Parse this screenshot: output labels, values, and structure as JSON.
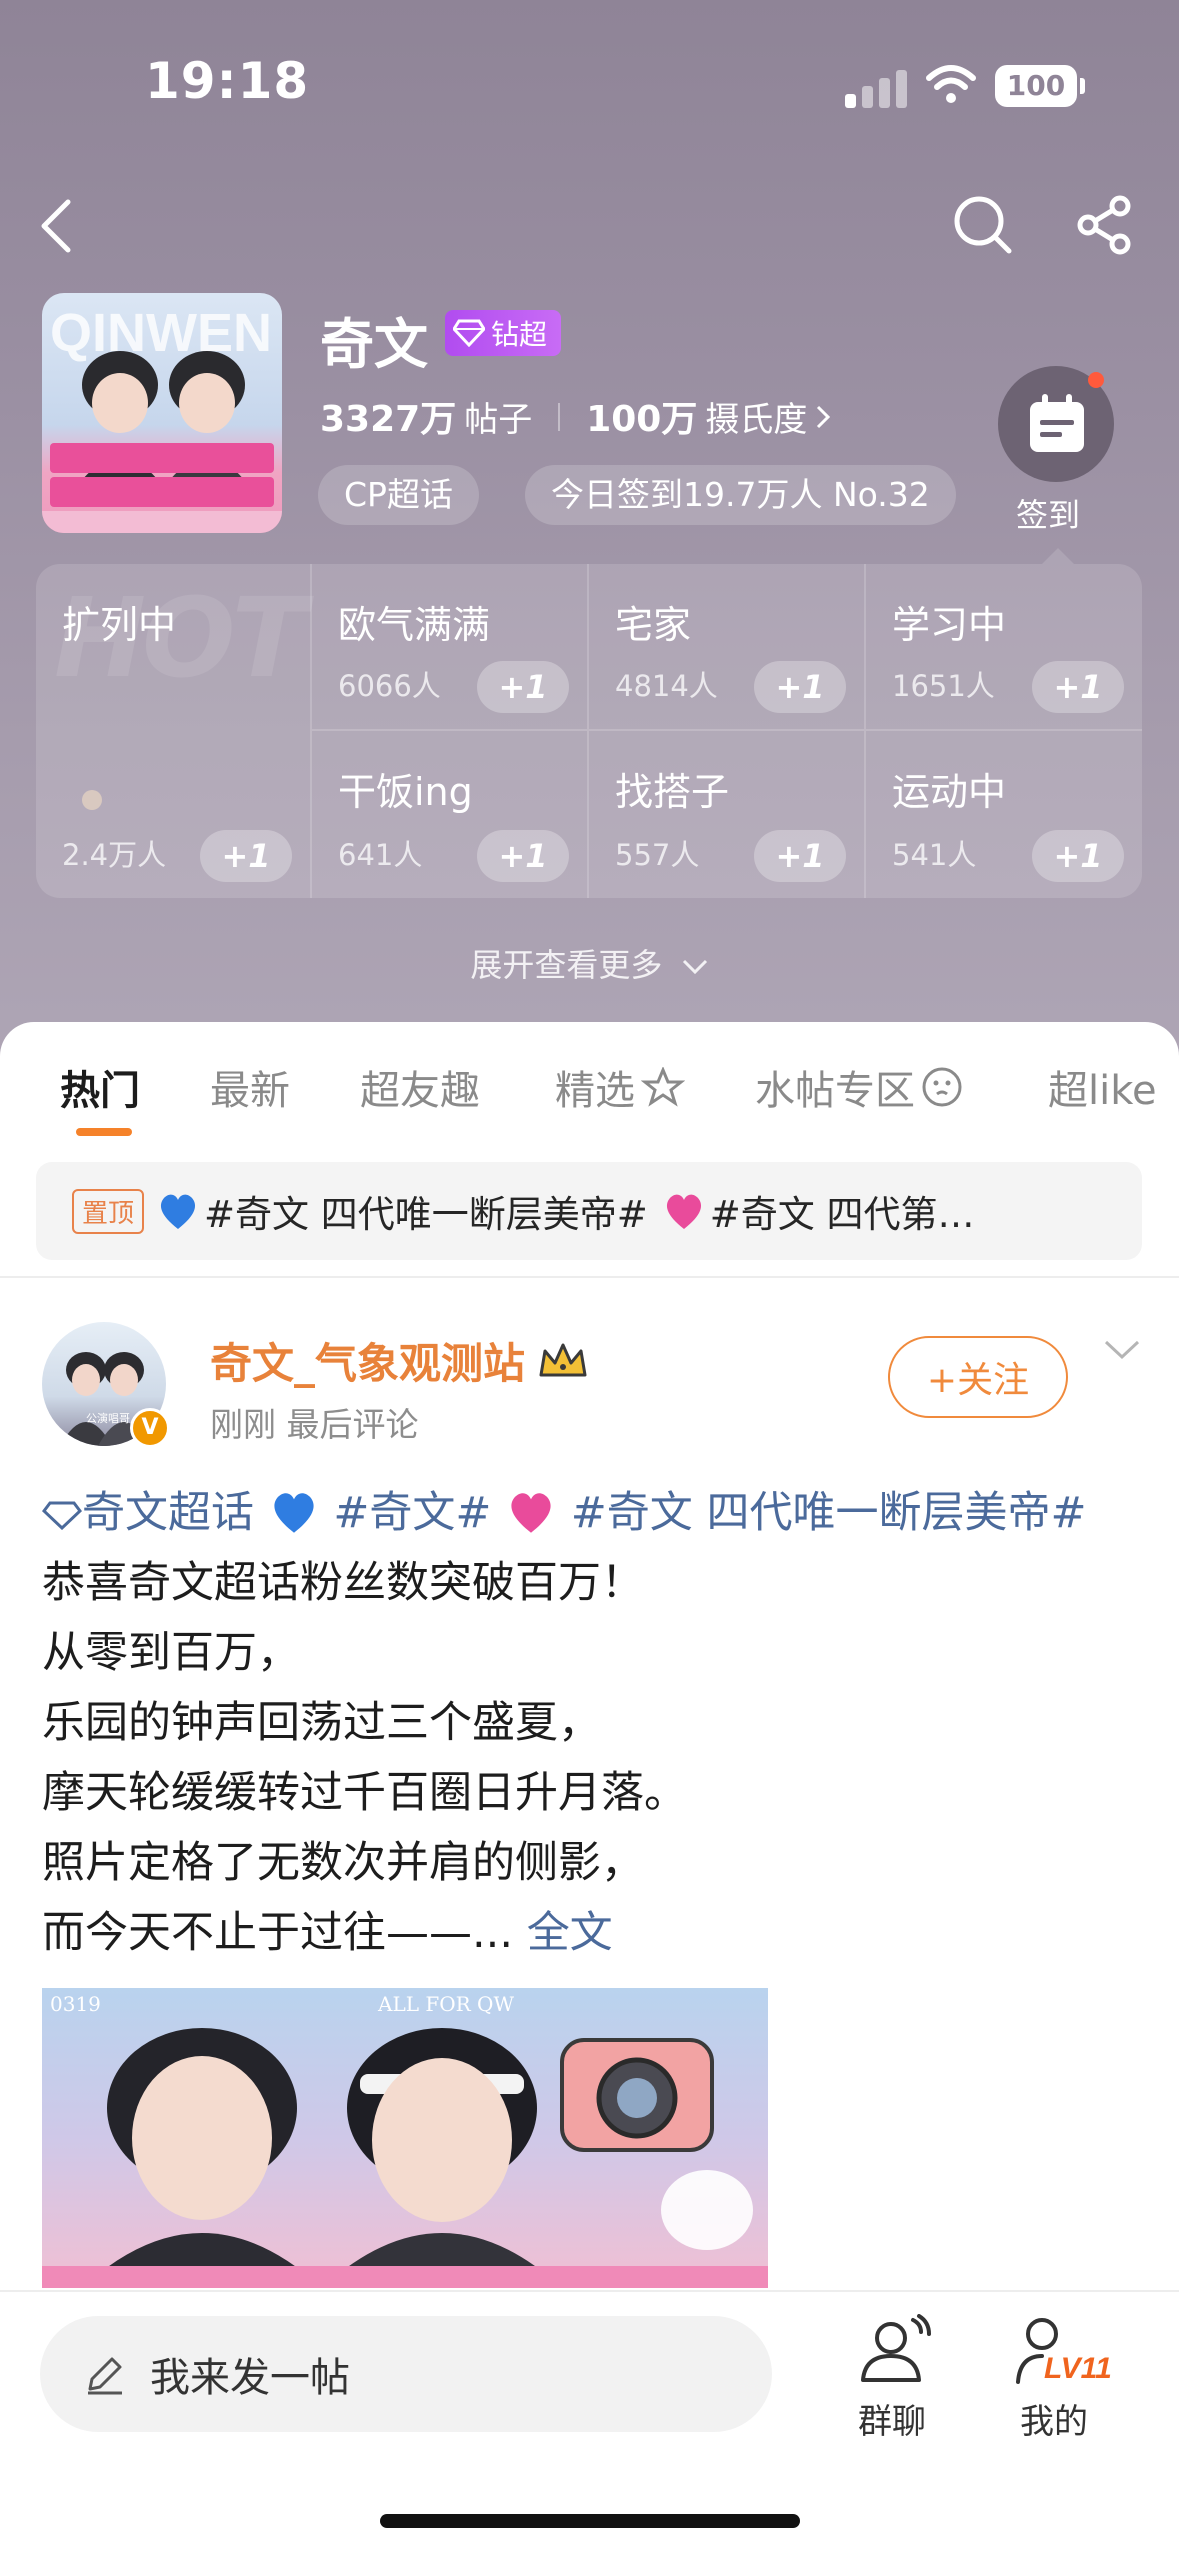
{
  "status_bar": {
    "time": "19:18",
    "battery": "100"
  },
  "topic": {
    "title": "奇文",
    "badge": "钻超",
    "posts_count": "3327万",
    "posts_label": "帖子",
    "fans_count": "100万",
    "fans_label": "摄氏度",
    "tag_cp": "CP超话",
    "checkin_stats": "今日签到19.7万人 No.32",
    "signin_label": "签到"
  },
  "grid": {
    "featured": {
      "name": "扩列中",
      "count": "2.4万人",
      "watermark": "HOT"
    },
    "cells": [
      {
        "name": "欧气满满",
        "count": "6066人"
      },
      {
        "name": "宅家",
        "count": "4814人"
      },
      {
        "name": "学习中",
        "count": "1651人"
      },
      {
        "name": "干饭ing",
        "count": "641人"
      },
      {
        "name": "找搭子",
        "count": "557人"
      },
      {
        "name": "运动中",
        "count": "541人"
      }
    ],
    "plus_label": "+1",
    "expand_label": "展开查看更多"
  },
  "tabs": [
    "热门",
    "最新",
    "超友趣",
    "精选",
    "水帖专区",
    "超like"
  ],
  "pinned": {
    "tag": "置顶",
    "text_1": "#奇文 四代唯一断层美帝#",
    "text_2": "#奇文 四代第…"
  },
  "post": {
    "author": "奇文_气象观测站",
    "meta": "刚刚 最后评论",
    "follow": "+关注",
    "topic_link": "奇文超话",
    "hashtag_1": "#奇文#",
    "hashtag_2": "#奇文 四代唯一断层美帝#",
    "lines": [
      "恭喜奇文超话粉丝数突破百万！",
      "从零到百万，",
      "乐园的钟声回荡过三个盛夏，",
      "摩天轮缓缓转过千百圈日升月落。",
      "照片定格了无数次并肩的侧影，",
      "而今天不止于过往——..."
    ],
    "full_text": "全文",
    "image_tag_left": "0319",
    "image_tag_center": "ALL  FOR  QW",
    "avatar_caption": "公演唱哥"
  },
  "bottom_bar": {
    "compose": "我来发一帖",
    "group_chat": "群聊",
    "mine": "我的",
    "level": "LV11"
  },
  "colors": {
    "accent": "#f5822a",
    "link": "#4b6a9b",
    "hero_top": "#8f8497",
    "badge": "#b14cf0"
  }
}
